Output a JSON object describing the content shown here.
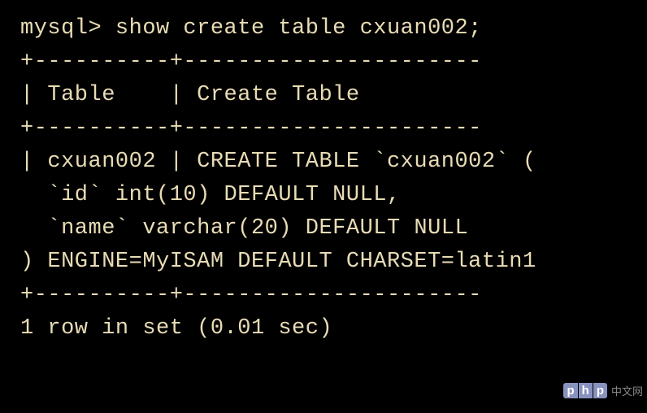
{
  "terminal": {
    "lines": [
      "mysql> show create table cxuan002;",
      "+----------+----------------------",
      "| Table    | Create Table",
      "+----------+----------------------",
      "| cxuan002 | CREATE TABLE `cxuan002` (",
      "  `id` int(10) DEFAULT NULL,",
      "  `name` varchar(20) DEFAULT NULL",
      ") ENGINE=MyISAM DEFAULT CHARSET=latin1",
      "+----------+----------------------",
      "1 row in set (0.01 sec)"
    ]
  },
  "watermark": {
    "brand": "php",
    "text": "中文网"
  }
}
